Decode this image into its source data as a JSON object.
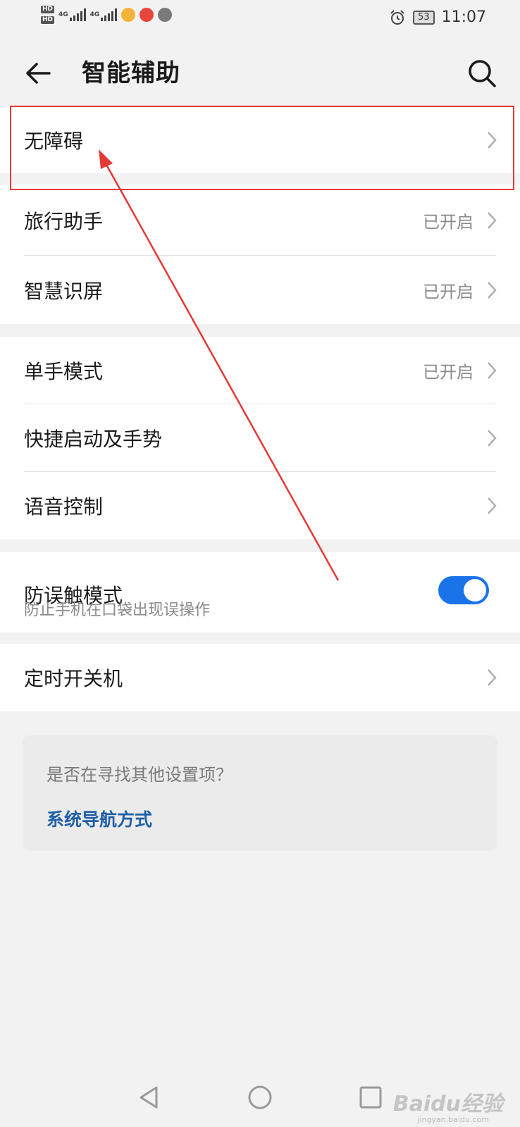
{
  "status_bar": {
    "hd1": "HD",
    "hd2": "HD",
    "net1": "4G",
    "net2": "4G",
    "battery": "53",
    "time": "11:07"
  },
  "header": {
    "title": "智能辅助"
  },
  "groups": {
    "accessibility": {
      "label": "无障碍"
    },
    "travel_assistant": {
      "label": "旅行助手",
      "value": "已开启"
    },
    "smart_screen": {
      "label": "智慧识屏",
      "value": "已开启"
    },
    "one_hand_mode": {
      "label": "单手模式",
      "value": "已开启"
    },
    "quick_launch": {
      "label": "快捷启动及手势"
    },
    "voice_control": {
      "label": "语音控制"
    },
    "pocket_mode": {
      "label": "防误触模式",
      "subtitle": "防止手机在口袋出现误操作",
      "enabled": true
    },
    "scheduled_power": {
      "label": "定时开关机"
    }
  },
  "hint": {
    "question": "是否在寻找其他设置项？",
    "link": "系统导航方式"
  },
  "watermark": {
    "text": "Baidu经验",
    "sub": "jingyan.baidu.com"
  },
  "colors": {
    "accent": "#1a73e8",
    "annotation": "#e53935",
    "link": "#1f5fa8"
  }
}
